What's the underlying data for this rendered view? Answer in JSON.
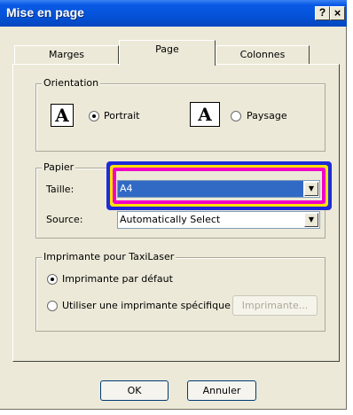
{
  "window": {
    "title": "Mise en page",
    "help_label": "?",
    "close_label": "×"
  },
  "tabs": [
    {
      "label": "Marges"
    },
    {
      "label": "Page"
    },
    {
      "label": "Colonnes"
    }
  ],
  "orientation": {
    "legend": "Orientation",
    "icon_glyph": "A",
    "portrait_label": "Portrait",
    "landscape_label": "Paysage",
    "selected": "Portrait"
  },
  "paper": {
    "legend": "Papier",
    "size_label": "Taille:",
    "size_value": "A4",
    "source_label": "Source:",
    "source_value": "Automatically Select"
  },
  "printer": {
    "legend": "Imprimante pour TaxiLaser",
    "default_label": "Imprimante par défaut",
    "specific_label": "Utiliser une imprimante spécifique",
    "printer_button": "Imprimante..."
  },
  "buttons": {
    "ok": "OK",
    "cancel": "Annuler"
  },
  "highlight_colors": {
    "outer": "#1e2bd8",
    "middle": "#ffe100",
    "inner": "#f000c8"
  }
}
